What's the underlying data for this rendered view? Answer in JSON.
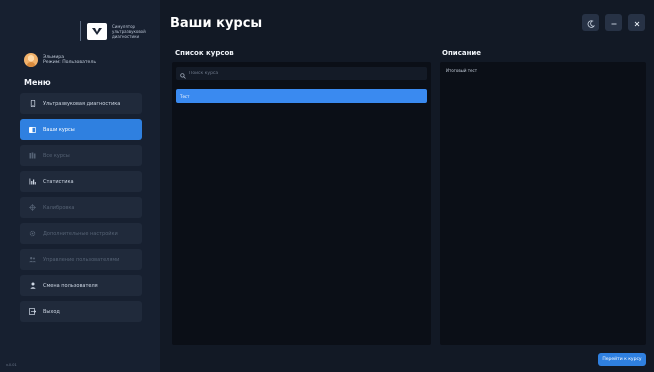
{
  "app": {
    "logo_text": "Симулятор ультразвуковой диагностики",
    "version": "v.0.01"
  },
  "user": {
    "name": "Эльмира",
    "role": "Режим: Пользователь"
  },
  "menu": {
    "title": "Меню",
    "items": [
      {
        "label": "Ультразвуковая диагностика",
        "icon": "phone-icon",
        "state": "normal"
      },
      {
        "label": "Ваши курсы",
        "icon": "book-icon",
        "state": "active"
      },
      {
        "label": "Все курсы",
        "icon": "books-icon",
        "state": "disabled"
      },
      {
        "label": "Статистика",
        "icon": "bar-chart-icon",
        "state": "normal"
      },
      {
        "label": "Калибровка",
        "icon": "crosshair-icon",
        "state": "disabled"
      },
      {
        "label": "Дополнительные настройки",
        "icon": "gear-icon",
        "state": "disabled"
      },
      {
        "label": "Управление пользователями",
        "icon": "users-icon",
        "state": "disabled"
      },
      {
        "label": "Смена пользователя",
        "icon": "user-icon",
        "state": "normal"
      },
      {
        "label": "Выход",
        "icon": "exit-icon",
        "state": "normal"
      }
    ]
  },
  "header": {
    "title": "Ваши курсы"
  },
  "window_controls": {
    "theme_icon": "moon-icon",
    "minimize_icon": "minimize-icon",
    "close_icon": "close-icon"
  },
  "courses": {
    "header": "Список курсов",
    "search_placeholder": "Поиск курса",
    "items": [
      "Тест"
    ]
  },
  "description": {
    "header": "Описание",
    "text": "Итоговый тест"
  },
  "actions": {
    "go_button": "Перейти к курсу"
  },
  "colors": {
    "accent": "#2f80e0",
    "sidebar_bg": "#172030",
    "main_bg": "#121925",
    "panel_bg": "#0b0f17"
  }
}
